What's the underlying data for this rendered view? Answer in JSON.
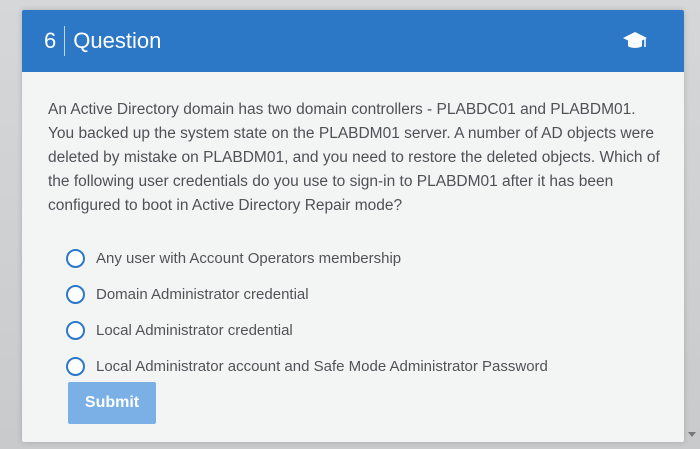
{
  "header": {
    "question_number": "6",
    "title": "Question",
    "icon": "graduation-cap-icon"
  },
  "question": {
    "text": "An Active Directory domain has two domain controllers - PLABDC01 and PLABDM01. You backed up the system state on the PLABDM01 server. A number of AD objects were deleted by mistake on PLABDM01, and you need to restore the deleted objects. Which of the following user credentials do you use to sign-in to PLABDM01 after it has been configured to boot in Active Directory Repair mode?"
  },
  "options": [
    {
      "label": "Any user with Account Operators membership",
      "selected": false
    },
    {
      "label": "Domain Administrator credential",
      "selected": false
    },
    {
      "label": "Local Administrator credential",
      "selected": false
    },
    {
      "label": "Local Administrator account and Safe Mode Administrator Password",
      "selected": false
    }
  ],
  "submit": {
    "label": "Submit"
  },
  "colors": {
    "header_bg": "#2c78c7",
    "submit_bg": "#7bb0e6",
    "radio_border": "#2c78c7"
  }
}
